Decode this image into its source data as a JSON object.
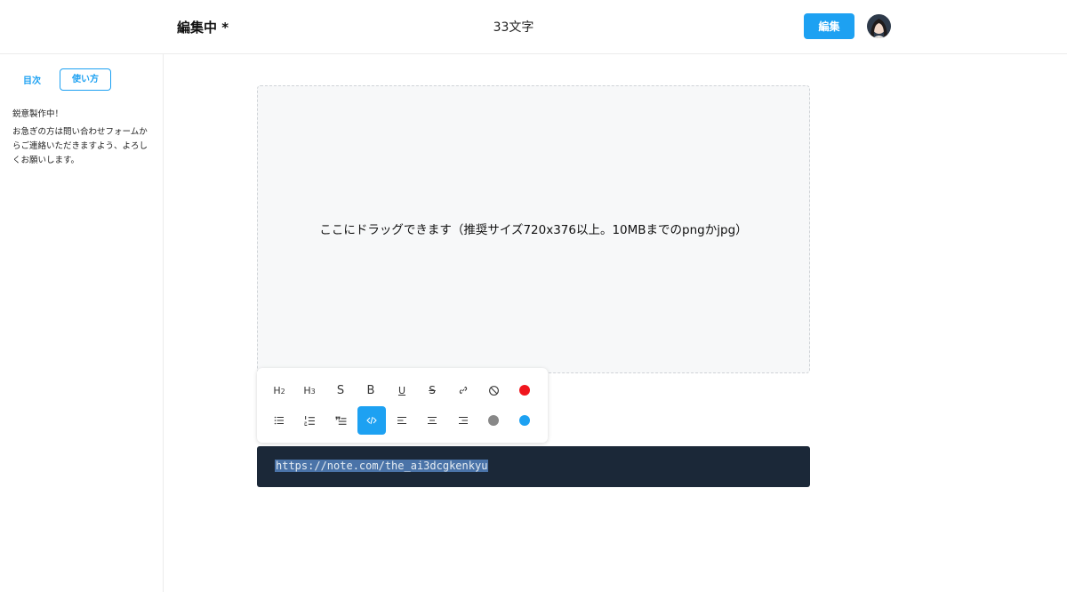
{
  "header": {
    "status_title": "編集中 *",
    "char_count": "33文字",
    "edit_button_label": "編集"
  },
  "sidebar": {
    "tabs": [
      {
        "label": "目次"
      },
      {
        "label": "使い方"
      }
    ],
    "notice_title": "鋭意製作中！",
    "notice_body": "お急ぎの方は問い合わせフォームからご連絡いただきますよう、よろしくお願いします。"
  },
  "dropzone": {
    "text": "ここにドラッグできます（推奨サイズ720x376以上。10MBまでのpngかjpg）"
  },
  "toolbar": {
    "row1": [
      {
        "name": "heading2",
        "label": "H2"
      },
      {
        "name": "heading3",
        "label": "H3"
      },
      {
        "name": "strikethrough-s",
        "label": "S"
      },
      {
        "name": "bold",
        "label": "B"
      },
      {
        "name": "underline",
        "label": "U"
      },
      {
        "name": "strikethrough",
        "label": "S"
      },
      {
        "name": "link",
        "icon": "link-icon"
      },
      {
        "name": "clear",
        "icon": "no-format-icon"
      },
      {
        "name": "color-red",
        "color": "#f0151d"
      }
    ],
    "row2": [
      {
        "name": "bullet-list",
        "icon": "bullet-list-icon"
      },
      {
        "name": "numbered-list",
        "icon": "numbered-list-icon"
      },
      {
        "name": "quote",
        "icon": "quote-icon"
      },
      {
        "name": "code",
        "icon": "code-icon",
        "active": true
      },
      {
        "name": "align-left",
        "icon": "align-left-icon"
      },
      {
        "name": "align-center",
        "icon": "align-center-icon"
      },
      {
        "name": "align-right",
        "icon": "align-right-icon"
      },
      {
        "name": "color-gray",
        "color": "#888888"
      },
      {
        "name": "color-blue",
        "color": "#1da1f2"
      }
    ]
  },
  "codeblock": {
    "text": "https://note.com/the_ai3dcgkenkyu"
  },
  "colors": {
    "accent": "#1da1f2",
    "code_bg": "#1b2838"
  }
}
